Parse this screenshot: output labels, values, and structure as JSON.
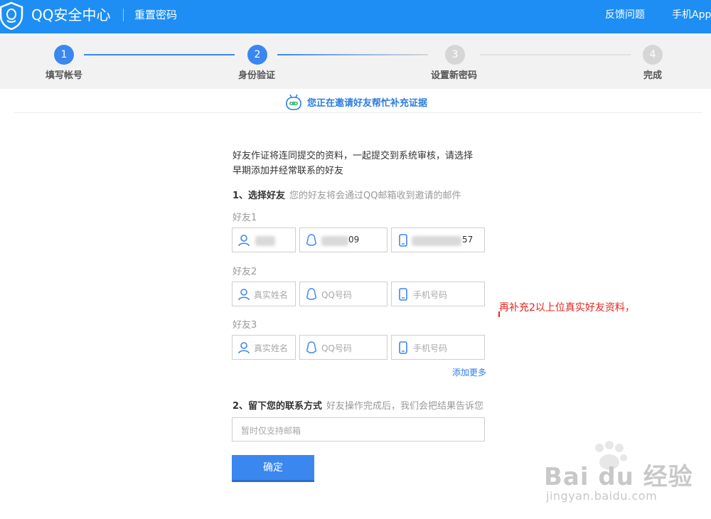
{
  "header": {
    "app_title": "QQ安全中心",
    "page_title": "重置密码",
    "feedback_link": "反馈问题",
    "mobile_app_link": "手机App"
  },
  "stepper": {
    "steps": [
      {
        "number": "1",
        "label": "填写帐号",
        "state": "done"
      },
      {
        "number": "2",
        "label": "身份验证",
        "state": "active"
      },
      {
        "number": "3",
        "label": "设置新密码",
        "state": "pending"
      },
      {
        "number": "4",
        "label": "完成",
        "state": "pending"
      }
    ]
  },
  "banner": {
    "text": "您正在邀请好友帮忙补充证据",
    "icon": "robot-icon"
  },
  "form": {
    "intro_line1": "好友作证将连同提交的资料，一起提交到系统审核，请选择",
    "intro_line2": "早期添加并经常联系的好友",
    "section1_title": "1、选择好友",
    "section1_hint": "您的好友将会通过QQ邮箱收到邀请的邮件",
    "friends": [
      {
        "label": "好友1",
        "name_value": "",
        "qq_value": "09",
        "phone_value": "57"
      },
      {
        "label": "好友2",
        "name_placeholder": "真实姓名",
        "qq_placeholder": "QQ号码",
        "phone_placeholder": "手机号码"
      },
      {
        "label": "好友3",
        "name_placeholder": "真实姓名",
        "qq_placeholder": "QQ号码",
        "phone_placeholder": "手机号码"
      }
    ],
    "add_more": "添加更多",
    "section2_title": "2、留下您的联系方式",
    "section2_hint": "好友操作完成后，我们会把结果告诉您",
    "email_placeholder": "暂时仅支持邮箱",
    "submit_label": "确定"
  },
  "annotation": "再补充2以上位真实好友资料，",
  "watermark": {
    "brand": "Bai du 经验",
    "url": "jingyan.baidu.com"
  },
  "colors": {
    "header_bg": "#1e8ef4",
    "accent": "#3a87f0",
    "link": "#2b7ce0",
    "annotation": "#e8231c"
  }
}
